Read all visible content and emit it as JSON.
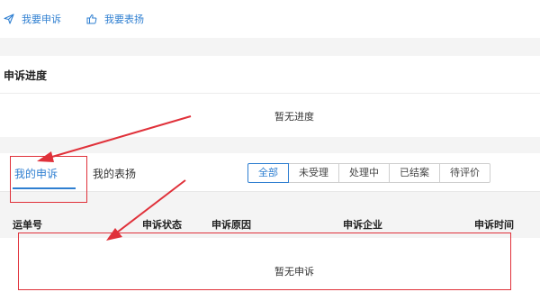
{
  "top_actions": [
    {
      "label": "我要申诉",
      "icon": "send-icon"
    },
    {
      "label": "我要表扬",
      "icon": "thumbs-up-icon"
    }
  ],
  "progress": {
    "title": "申诉进度",
    "empty_text": "暂无进度"
  },
  "tabs": [
    {
      "label": "我的申诉",
      "active": true
    },
    {
      "label": "我的表扬",
      "active": false
    }
  ],
  "filters": [
    {
      "label": "全部",
      "active": true
    },
    {
      "label": "未受理",
      "active": false
    },
    {
      "label": "处理中",
      "active": false
    },
    {
      "label": "已结案",
      "active": false
    },
    {
      "label": "待评价",
      "active": false
    }
  ],
  "table": {
    "columns": [
      "运单号",
      "申诉状态",
      "申诉原因",
      "申诉企业",
      "申诉时间"
    ],
    "empty_text": "暂无申诉"
  },
  "colors": {
    "accent": "#2f7fd1",
    "annotation": "#e0313a"
  }
}
